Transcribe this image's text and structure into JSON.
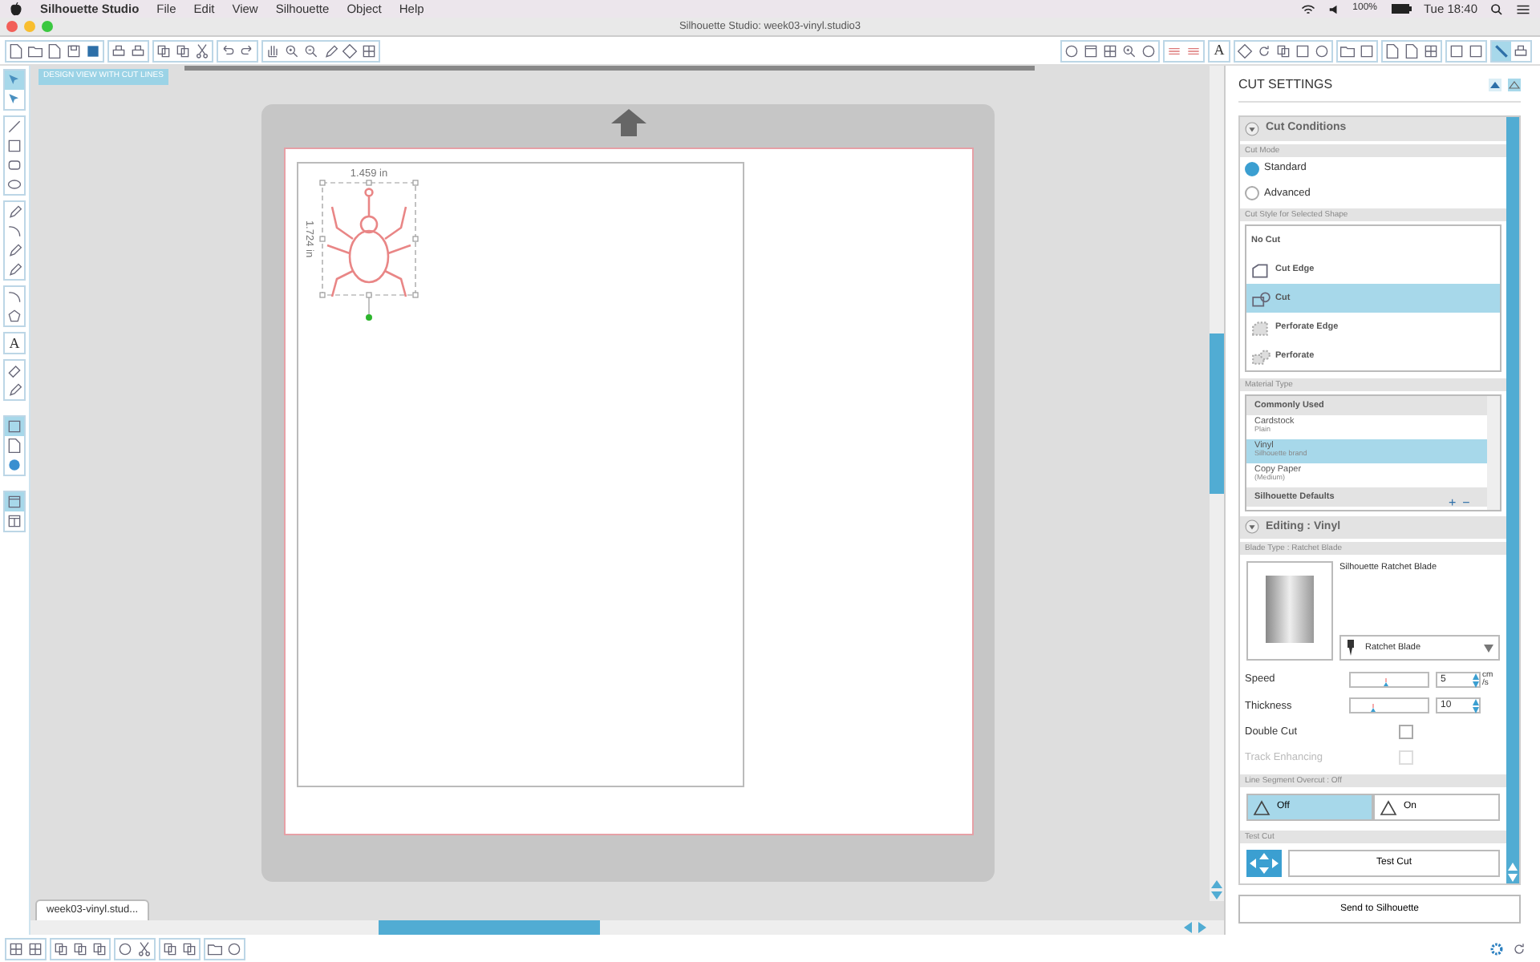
{
  "menu_bar": {
    "app": "Silhouette Studio",
    "menus": [
      "File",
      "Edit",
      "View",
      "Silhouette",
      "Object",
      "Help"
    ],
    "battery": "100%",
    "clock": "Tue 18:40"
  },
  "window": {
    "title": "Silhouette Studio: week03-vinyl.studio3"
  },
  "toolbar": {
    "text_style_glyph": "A"
  },
  "tools": {
    "text_tool_glyph": "A"
  },
  "view_mode": "DESIGN VIEW WITH CUT LINES",
  "canvas": {
    "width_label": "1.459 in",
    "height_label": "1.724 in"
  },
  "document_tabs": [
    {
      "label": "week03-vinyl.stud...",
      "selected": true
    }
  ],
  "cut_settings": {
    "title": "CUT SETTINGS",
    "cut_conditions": {
      "header": "Cut Conditions",
      "cut_mode_label": "Cut Mode",
      "modes": [
        {
          "label": "Standard",
          "selected": true
        },
        {
          "label": "Advanced",
          "selected": false
        }
      ],
      "cut_style_label": "Cut Style for Selected Shape",
      "cut_styles": [
        {
          "label": "No Cut",
          "kind": "none",
          "selected": false
        },
        {
          "label": "Cut Edge",
          "kind": "edge",
          "selected": false
        },
        {
          "label": "Cut",
          "kind": "cut",
          "selected": true
        },
        {
          "label": "Perforate Edge",
          "kind": "perf-edge",
          "selected": false
        },
        {
          "label": "Perforate",
          "kind": "perf",
          "selected": false
        }
      ],
      "material_label": "Material Type",
      "materials": [
        {
          "kind": "group",
          "label": "Commonly Used"
        },
        {
          "kind": "item",
          "label": "Cardstock",
          "sub": "Plain",
          "selected": false
        },
        {
          "kind": "item",
          "label": "Vinyl",
          "sub": "Silhouette brand",
          "selected": true
        },
        {
          "kind": "item",
          "label": "Copy Paper",
          "sub": "(Medium)",
          "selected": false
        },
        {
          "kind": "group",
          "label": "Silhouette Defaults"
        }
      ],
      "material_buttons": [
        "+",
        "−"
      ]
    },
    "editing": {
      "header": "Editing : Vinyl",
      "blade_type_label": "Blade Type : Ratchet Blade",
      "blade_name": "Silhouette Ratchet Blade",
      "blade_select": "Ratchet Blade",
      "sliders": [
        {
          "label": "Speed",
          "level": 0.45,
          "value": "5",
          "unit": [
            "cm",
            "/s"
          ]
        },
        {
          "label": "Thickness",
          "level": 0.3,
          "value": "10"
        }
      ],
      "options": [
        {
          "label": "Double Cut",
          "checked": false,
          "disabled": false
        },
        {
          "label": "Track Enhancing",
          "checked": false,
          "disabled": true
        }
      ],
      "overcut_label": "Line Segment Overcut : Off",
      "overcut": [
        {
          "label": "Off",
          "selected": true
        },
        {
          "label": "On",
          "selected": false
        }
      ],
      "test_cut_label": "Test Cut",
      "test_cut_button": "Test Cut"
    },
    "send_button": "Send to Silhouette"
  }
}
